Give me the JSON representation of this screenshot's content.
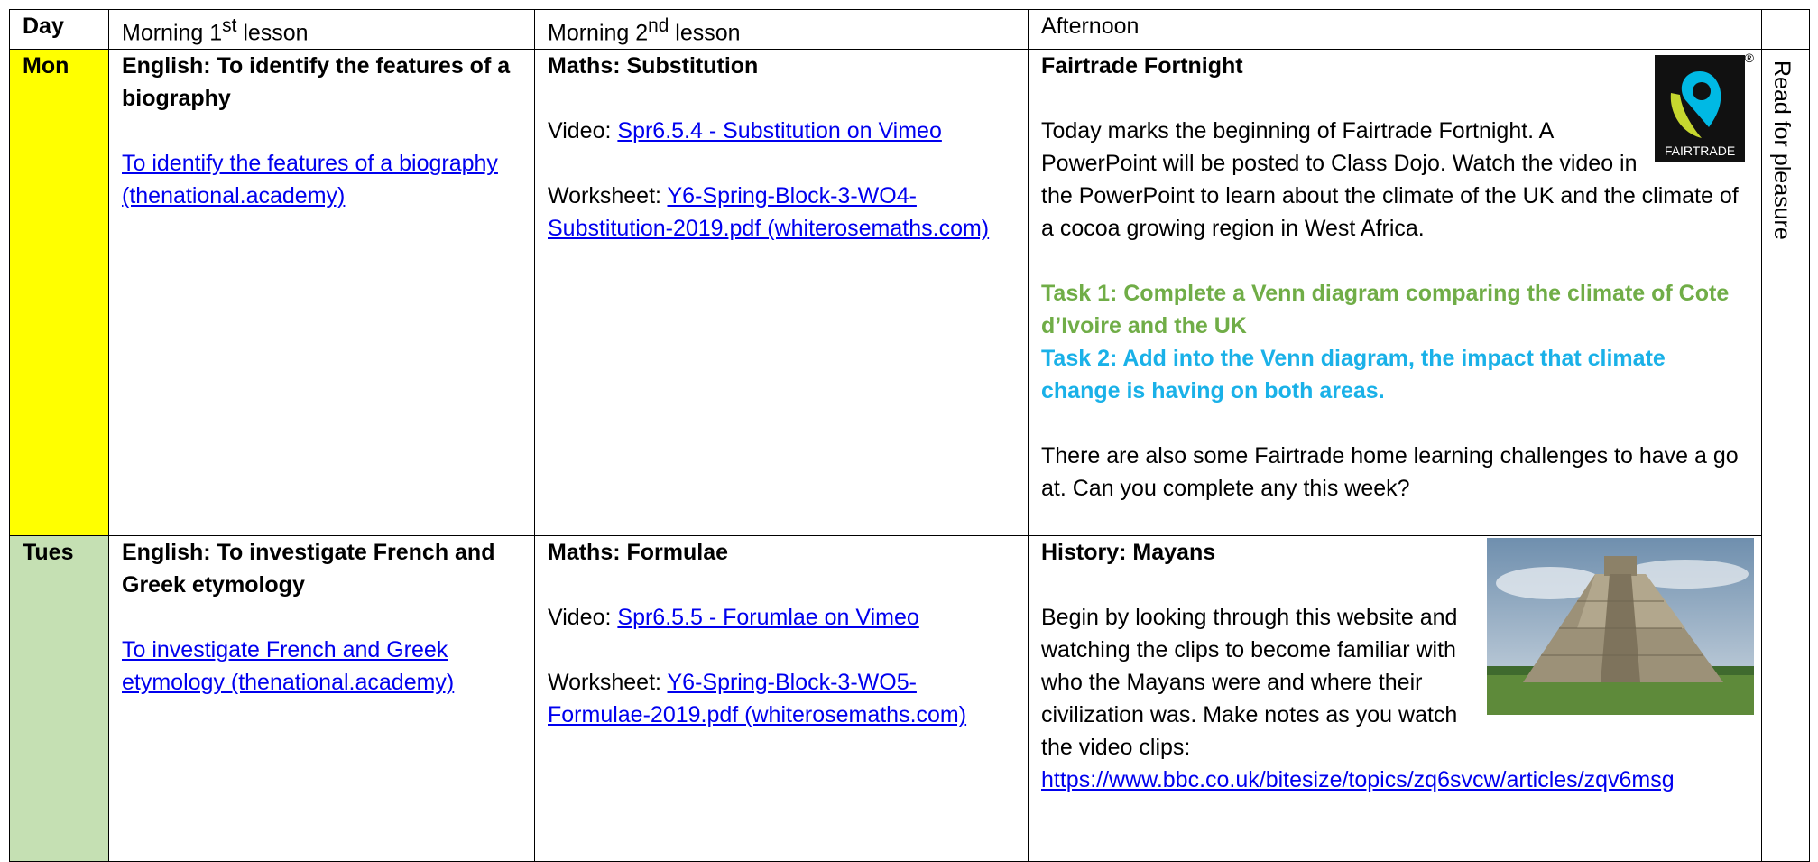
{
  "header": {
    "day": "Day",
    "morning1_pre": "Morning 1",
    "morning1_sup": "st",
    "morning1_post": " lesson",
    "morning2_pre": "Morning 2",
    "morning2_sup": "nd",
    "morning2_post": " lesson",
    "afternoon": "Afternoon"
  },
  "side_label": "Read for pleasure",
  "colors": {
    "mon_day": "#ffff00",
    "tue_day": "#c5e0b3",
    "task1": "#70ad47",
    "task2": "#1ab1e8",
    "link": "#0000ee"
  },
  "rows": [
    {
      "day": "Mon",
      "m1": {
        "title": "English: To identify the features of a biography",
        "link": "To identify the features of a biography (thenational.academy)"
      },
      "m2": {
        "title": "Maths: Substitution",
        "video_label": "Video: ",
        "video_link": "Spr6.5.4 - Substitution on Vimeo",
        "worksheet_label": "Worksheet: ",
        "worksheet_link": "Y6-Spring-Block-3-WO4-Substitution-2019.pdf (whiterosemaths.com)"
      },
      "aft": {
        "title": "Fairtrade Fortnight",
        "logo_text": "FAIRTRADE",
        "logo_reg": "®",
        "para1": "Today marks the beginning of Fairtrade Fortnight. A PowerPoint will be posted to Class Dojo. Watch the video in the PowerPoint to learn about the climate of the UK and the climate of a cocoa growing region in West Africa.",
        "task1": "Task 1: Complete a Venn diagram comparing the climate of Cote d’Ivoire and the UK",
        "task2": "Task 2: Add into the Venn diagram, the impact that climate change is having on both areas.",
        "para2": "There are also some Fairtrade home learning challenges to have a go at. Can you complete any this week?"
      }
    },
    {
      "day": "Tues",
      "m1": {
        "title": "English: To investigate French and Greek etymology",
        "link": "To investigate French and Greek etymology (thenational.academy)"
      },
      "m2": {
        "title": "Maths: Formulae",
        "video_label": "Video: ",
        "video_link": "Spr6.5.5 - Forumlae on Vimeo",
        "worksheet_label": "Worksheet: ",
        "worksheet_link": "Y6-Spring-Block-3-WO5-Formulae-2019.pdf (whiterosemaths.com)"
      },
      "aft": {
        "title": "History: Mayans",
        "para1": "Begin by looking through this website and watching the clips to become familiar with who the Mayans were and where their civilization was. Make notes as you watch the video clips:",
        "url": "https://www.bbc.co.uk/bitesize/topics/zq6svcw/articles/zqv6msg"
      }
    }
  ]
}
